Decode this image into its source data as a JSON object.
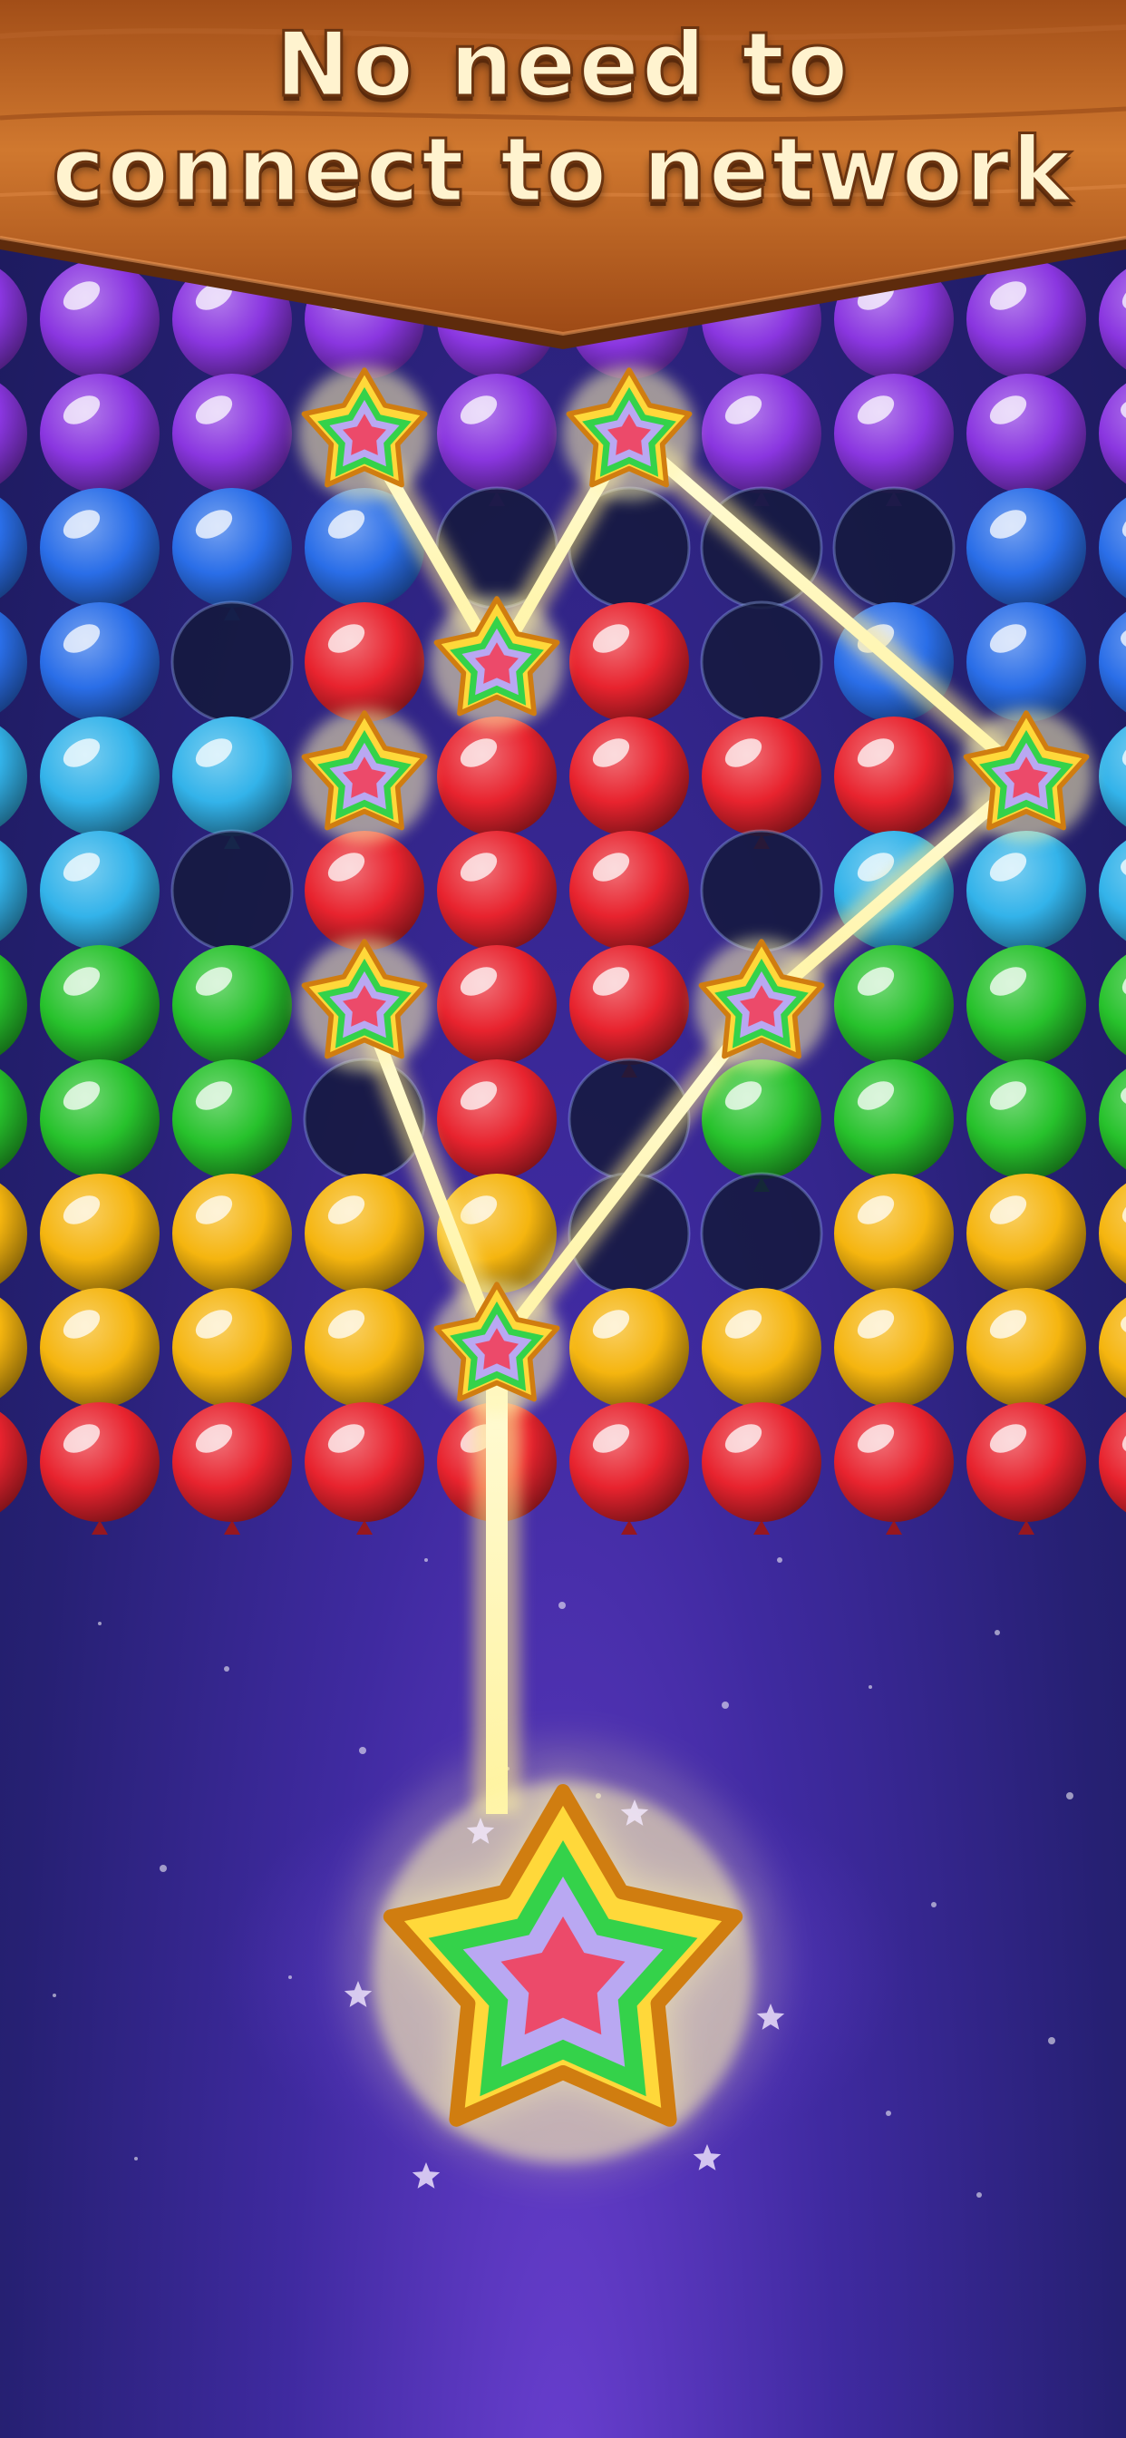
{
  "banner": {
    "line1": "No need to",
    "line2": "connect to network"
  },
  "colors": {
    "purple": "#8a36e0",
    "blue": "#2a6ee8",
    "cyan": "#33b3ea",
    "green": "#27c22c",
    "yellow": "#f5b50f",
    "red": "#e8232e",
    "wood": "#c26a2a",
    "background": "#2b2277",
    "glow": "#fff6b0"
  },
  "icons": {
    "star_bubble": "star-bubble-icon",
    "shooter": "star-shooter-icon"
  },
  "board": {
    "rows": [
      [
        "purple",
        "purple",
        "purple",
        "purple",
        "purple",
        "purple",
        "purple",
        "purple",
        "purple"
      ],
      [
        "purple",
        "purple",
        "purple",
        "star",
        "purple",
        "star",
        "purple",
        "purple",
        "purple"
      ],
      [
        "blue",
        "blue",
        "blue",
        "empty",
        "empty",
        "empty",
        "empty",
        "blue",
        "blue"
      ],
      [
        "blue",
        "blue",
        "empty",
        "red",
        "star",
        "red",
        "empty",
        "blue",
        "blue"
      ],
      [
        "cyan",
        "cyan",
        "star",
        "red",
        "red",
        "red",
        "red",
        "star",
        "cyan"
      ],
      [
        "cyan",
        "cyan",
        "empty",
        "red",
        "red",
        "red",
        "empty",
        "cyan",
        "cyan"
      ],
      [
        "green",
        "green",
        "star",
        "red",
        "red",
        "star",
        "green",
        "green",
        "green"
      ],
      [
        "green",
        "green",
        "green",
        "empty",
        "red",
        "empty",
        "green",
        "green",
        "green"
      ],
      [
        "yellow",
        "yellow",
        "yellow",
        "yellow",
        "empty",
        "empty",
        "yellow",
        "yellow",
        "yellow"
      ],
      [
        "yellow",
        "yellow",
        "yellow",
        "yellow",
        "star",
        "yellow",
        "yellow",
        "yellow",
        "yellow"
      ],
      [
        "red",
        "red",
        "red",
        "red",
        "red",
        "red",
        "red",
        "red",
        "red"
      ]
    ]
  }
}
